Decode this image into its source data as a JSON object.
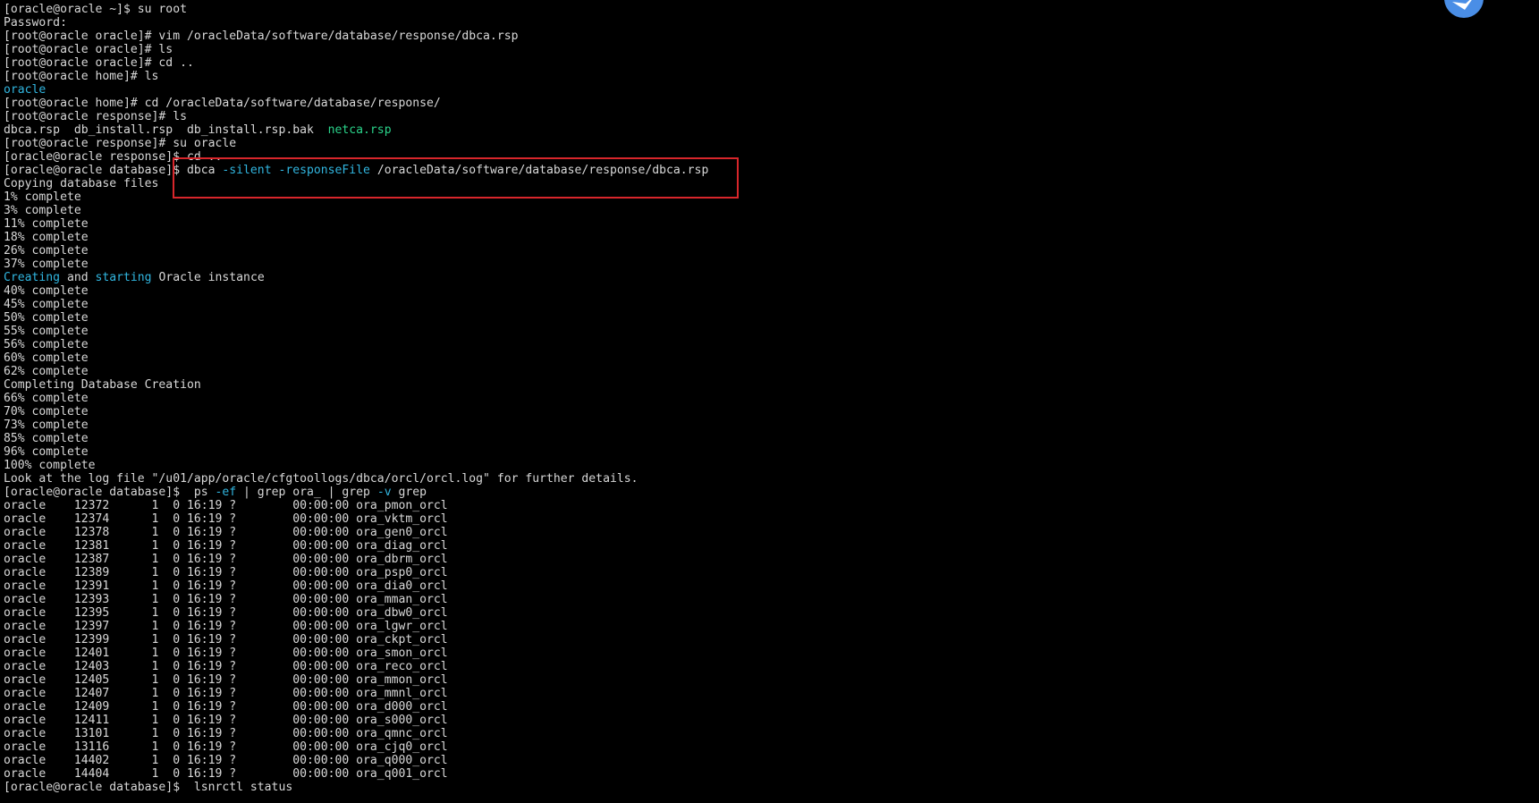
{
  "colors": {
    "background": "#000000",
    "text": "#d8d8d8",
    "cyan": "#31b6e0",
    "green": "#2ad38a",
    "highlight_border": "#d8262b",
    "badge": "#4a8ee6"
  },
  "badge_icon": "bird-logo-icon",
  "lines": [
    {
      "segments": [
        {
          "text": "[oracle@oracle ~]$ su root"
        }
      ]
    },
    {
      "segments": [
        {
          "text": "Password:"
        }
      ]
    },
    {
      "segments": [
        {
          "text": "[root@oracle oracle]# vim /oracleData/software/database/response/dbca.rsp"
        }
      ]
    },
    {
      "segments": [
        {
          "text": "[root@oracle oracle]# ls"
        }
      ]
    },
    {
      "segments": [
        {
          "text": "[root@oracle oracle]# cd .."
        }
      ]
    },
    {
      "segments": [
        {
          "text": "[root@oracle home]# ls"
        }
      ]
    },
    {
      "segments": [
        {
          "text": "oracle",
          "color": "cyan"
        }
      ]
    },
    {
      "segments": [
        {
          "text": "[root@oracle home]# cd /oracleData/software/database/response/"
        }
      ]
    },
    {
      "segments": [
        {
          "text": "[root@oracle response]# ls"
        }
      ]
    },
    {
      "segments": [
        {
          "text": "dbca.rsp  db_install.rsp  db_install.rsp.bak  "
        },
        {
          "text": "netca.rsp",
          "color": "green"
        }
      ]
    },
    {
      "segments": [
        {
          "text": "[root@oracle response]# su oracle"
        }
      ]
    },
    {
      "segments": [
        {
          "text": "[oracle@oracle response]$ cd .."
        }
      ]
    },
    {
      "segments": [
        {
          "text": "[oracle@oracle database]$ dbca "
        },
        {
          "text": "-silent -responseFile",
          "color": "cyan"
        },
        {
          "text": " /oracleData/software/database/response/dbca.rsp"
        }
      ]
    },
    {
      "segments": [
        {
          "text": "Copying database files"
        }
      ]
    },
    {
      "segments": [
        {
          "text": "1% complete"
        }
      ]
    },
    {
      "segments": [
        {
          "text": "3% complete"
        }
      ]
    },
    {
      "segments": [
        {
          "text": "11% complete"
        }
      ]
    },
    {
      "segments": [
        {
          "text": "18% complete"
        }
      ]
    },
    {
      "segments": [
        {
          "text": "26% complete"
        }
      ]
    },
    {
      "segments": [
        {
          "text": "37% complete"
        }
      ]
    },
    {
      "segments": [
        {
          "text": "Creating",
          "color": "cyan"
        },
        {
          "text": " and "
        },
        {
          "text": "starting",
          "color": "cyan"
        },
        {
          "text": " Oracle instance"
        }
      ]
    },
    {
      "segments": [
        {
          "text": "40% complete"
        }
      ]
    },
    {
      "segments": [
        {
          "text": "45% complete"
        }
      ]
    },
    {
      "segments": [
        {
          "text": "50% complete"
        }
      ]
    },
    {
      "segments": [
        {
          "text": "55% complete"
        }
      ]
    },
    {
      "segments": [
        {
          "text": "56% complete"
        }
      ]
    },
    {
      "segments": [
        {
          "text": "60% complete"
        }
      ]
    },
    {
      "segments": [
        {
          "text": "62% complete"
        }
      ]
    },
    {
      "segments": [
        {
          "text": "Completing Database Creation"
        }
      ]
    },
    {
      "segments": [
        {
          "text": "66% complete"
        }
      ]
    },
    {
      "segments": [
        {
          "text": "70% complete"
        }
      ]
    },
    {
      "segments": [
        {
          "text": "73% complete"
        }
      ]
    },
    {
      "segments": [
        {
          "text": "85% complete"
        }
      ]
    },
    {
      "segments": [
        {
          "text": "96% complete"
        }
      ]
    },
    {
      "segments": [
        {
          "text": "100% complete"
        }
      ]
    },
    {
      "segments": [
        {
          "text": "Look at the log file \"/u01/app/oracle/cfgtoollogs/dbca/orcl/orcl.log\" for further details."
        }
      ]
    },
    {
      "segments": [
        {
          "text": "[oracle@oracle database]$  ps "
        },
        {
          "text": "-ef",
          "color": "cyan"
        },
        {
          "text": " | grep ora_ | grep "
        },
        {
          "text": "-v",
          "color": "cyan"
        },
        {
          "text": " grep"
        }
      ]
    },
    {
      "segments": [
        {
          "text": "oracle    12372      1  0 16:19 ?        00:00:00 ora_pmon_orcl"
        }
      ]
    },
    {
      "segments": [
        {
          "text": "oracle    12374      1  0 16:19 ?        00:00:00 ora_vktm_orcl"
        }
      ]
    },
    {
      "segments": [
        {
          "text": "oracle    12378      1  0 16:19 ?        00:00:00 ora_gen0_orcl"
        }
      ]
    },
    {
      "segments": [
        {
          "text": "oracle    12381      1  0 16:19 ?        00:00:00 ora_diag_orcl"
        }
      ]
    },
    {
      "segments": [
        {
          "text": "oracle    12387      1  0 16:19 ?        00:00:00 ora_dbrm_orcl"
        }
      ]
    },
    {
      "segments": [
        {
          "text": "oracle    12389      1  0 16:19 ?        00:00:00 ora_psp0_orcl"
        }
      ]
    },
    {
      "segments": [
        {
          "text": "oracle    12391      1  0 16:19 ?        00:00:00 ora_dia0_orcl"
        }
      ]
    },
    {
      "segments": [
        {
          "text": "oracle    12393      1  0 16:19 ?        00:00:00 ora_mman_orcl"
        }
      ]
    },
    {
      "segments": [
        {
          "text": "oracle    12395      1  0 16:19 ?        00:00:00 ora_dbw0_orcl"
        }
      ]
    },
    {
      "segments": [
        {
          "text": "oracle    12397      1  0 16:19 ?        00:00:00 ora_lgwr_orcl"
        }
      ]
    },
    {
      "segments": [
        {
          "text": "oracle    12399      1  0 16:19 ?        00:00:00 ora_ckpt_orcl"
        }
      ]
    },
    {
      "segments": [
        {
          "text": "oracle    12401      1  0 16:19 ?        00:00:00 ora_smon_orcl"
        }
      ]
    },
    {
      "segments": [
        {
          "text": "oracle    12403      1  0 16:19 ?        00:00:00 ora_reco_orcl"
        }
      ]
    },
    {
      "segments": [
        {
          "text": "oracle    12405      1  0 16:19 ?        00:00:00 ora_mmon_orcl"
        }
      ]
    },
    {
      "segments": [
        {
          "text": "oracle    12407      1  0 16:19 ?        00:00:00 ora_mmnl_orcl"
        }
      ]
    },
    {
      "segments": [
        {
          "text": "oracle    12409      1  0 16:19 ?        00:00:00 ora_d000_orcl"
        }
      ]
    },
    {
      "segments": [
        {
          "text": "oracle    12411      1  0 16:19 ?        00:00:00 ora_s000_orcl"
        }
      ]
    },
    {
      "segments": [
        {
          "text": "oracle    13101      1  0 16:19 ?        00:00:00 ora_qmnc_orcl"
        }
      ]
    },
    {
      "segments": [
        {
          "text": "oracle    13116      1  0 16:19 ?        00:00:00 ora_cjq0_orcl"
        }
      ]
    },
    {
      "segments": [
        {
          "text": "oracle    14402      1  0 16:19 ?        00:00:00 ora_q000_orcl"
        }
      ]
    },
    {
      "segments": [
        {
          "text": "oracle    14404      1  0 16:19 ?        00:00:00 ora_q001_orcl"
        }
      ]
    },
    {
      "segments": [
        {
          "text": "[oracle@oracle database]$  lsnrctl status"
        }
      ]
    }
  ]
}
